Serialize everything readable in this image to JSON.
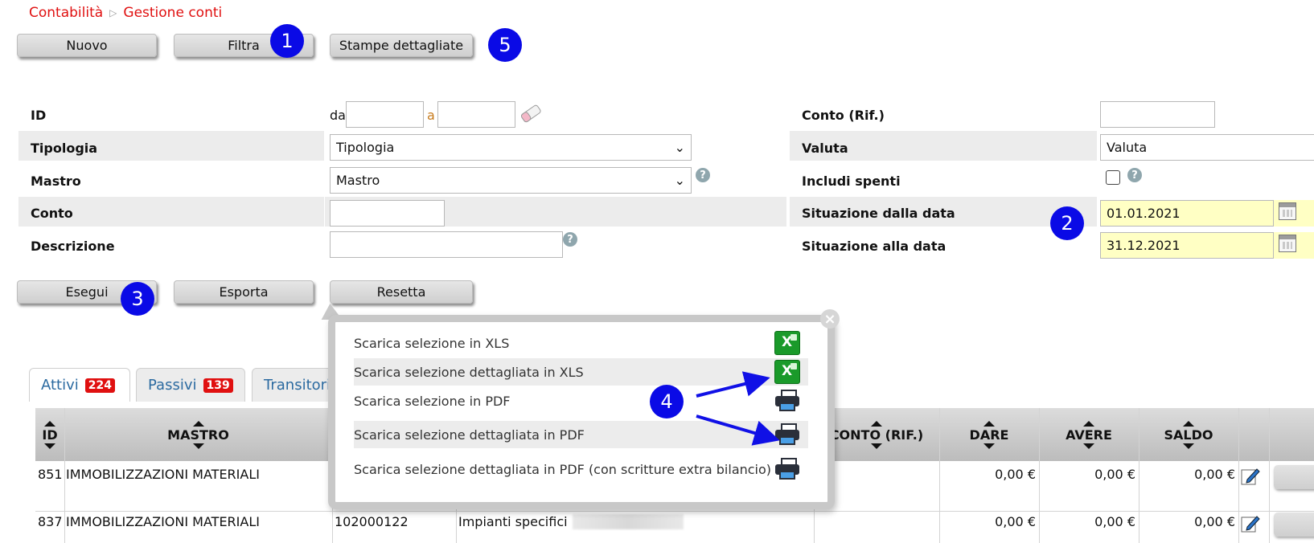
{
  "breadcrumb": {
    "items": [
      "Contabilità",
      "Gestione conti"
    ]
  },
  "toolbar": {
    "nuovo": "Nuovo",
    "filtra": "Filtra",
    "stampe": "Stampe dettagliate"
  },
  "badges": {
    "b1": "1",
    "b2": "2",
    "b3": "3",
    "b4": "4",
    "b5": "5"
  },
  "filters": {
    "id": {
      "label": "ID",
      "from_label": "da",
      "to_label": "a",
      "from_value": "",
      "to_value": ""
    },
    "tipologia": {
      "label": "Tipologia",
      "selected": "Tipologia"
    },
    "mastro": {
      "label": "Mastro",
      "selected": "Mastro"
    },
    "conto": {
      "label": "Conto",
      "value": ""
    },
    "descrizione": {
      "label": "Descrizione",
      "value": ""
    },
    "conto_rif": {
      "label": "Conto (Rif.)",
      "value": ""
    },
    "valuta": {
      "label": "Valuta",
      "selected": "Valuta"
    },
    "includi_spenti": {
      "label": "Includi spenti",
      "checked": false
    },
    "situazione_dal": {
      "label": "Situazione dalla data",
      "value": "01.01.2021"
    },
    "situazione_al": {
      "label": "Situazione alla data",
      "value": "31.12.2021"
    },
    "help": "?"
  },
  "actions": {
    "esegui": "Esegui",
    "esporta": "Esporta",
    "resetta": "Resetta"
  },
  "tabs": [
    {
      "label": "Attivi",
      "count": "224"
    },
    {
      "label": "Passivi",
      "count": "139"
    },
    {
      "label": "Transitori",
      "count": ""
    }
  ],
  "table": {
    "headers": {
      "id": "ID",
      "mastro": "MASTRO",
      "conto_rif": "CONTO (RIF.)",
      "dare": "DARE",
      "avere": "AVERE",
      "saldo": "SALDO"
    },
    "rows": [
      {
        "id": "851",
        "mastro": "IMMOBILIZZAZIONI MATERIALI",
        "conto": "",
        "descrizione": "",
        "dare": "0,00 €",
        "avere": "0,00 €",
        "saldo": "0,00 €"
      },
      {
        "id": "837",
        "mastro": "IMMOBILIZZAZIONI MATERIALI",
        "conto": "102000122",
        "descrizione": "Impianti specifici",
        "dare": "0,00 €",
        "avere": "0,00 €",
        "saldo": "0,00 €"
      }
    ]
  },
  "export_popup": {
    "close": "×",
    "options": [
      {
        "label": "Scarica selezione in XLS",
        "icon": "xls-icon"
      },
      {
        "label": "Scarica selezione dettagliata in XLS",
        "icon": "xls-icon"
      },
      {
        "label": "Scarica selezione in PDF",
        "icon": "printer-icon"
      },
      {
        "label": "Scarica selezione dettagliata in PDF",
        "icon": "printer-icon"
      },
      {
        "label": "Scarica selezione dettagliata in PDF (con scritture extra bilancio)",
        "icon": "printer-icon"
      }
    ],
    "xls_glyph": "X"
  },
  "colors": {
    "breadcrumb": "#e01010",
    "badge": "#0a0ae6",
    "tab_text": "#2b6aa0",
    "count_badge": "#e01010",
    "date_bg": "#ffffc4"
  }
}
